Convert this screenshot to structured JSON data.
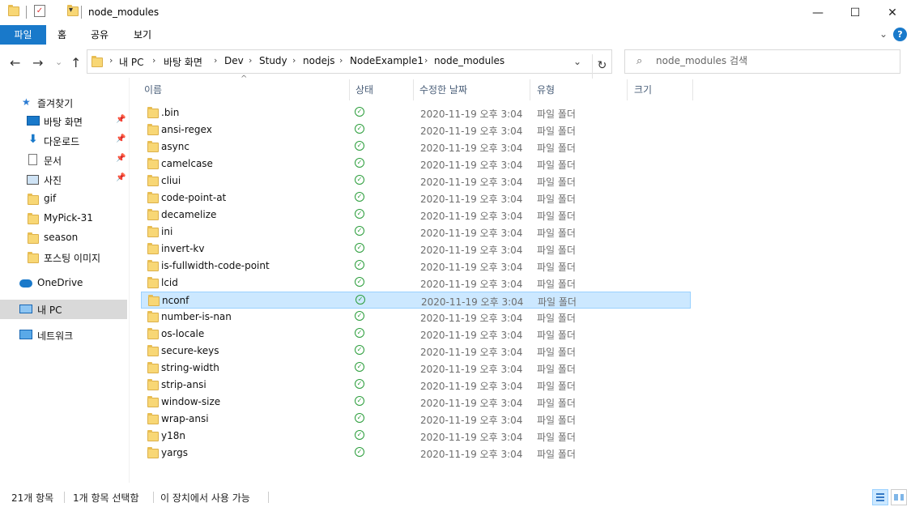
{
  "title": "node_modules",
  "ribbon": {
    "tabs": [
      "파일",
      "홈",
      "공유",
      "보기"
    ]
  },
  "window_controls": {
    "minimize": "—",
    "maximize": "☐",
    "close": "✕"
  },
  "nav": {
    "back": "←",
    "forward": "→",
    "recent": "⌄",
    "up": "↑",
    "refresh": "↻"
  },
  "breadcrumb": [
    "내 PC",
    "바탕 화면",
    "Dev",
    "Study",
    "nodejs",
    "NodeExample1",
    "node_modules"
  ],
  "search": {
    "placeholder": "node_modules 검색"
  },
  "sidebar": {
    "quick_access": "즐겨찾기",
    "items": [
      {
        "label": "바탕 화면",
        "icon": "desktop-icon",
        "pinned": true
      },
      {
        "label": "다운로드",
        "icon": "download-icon",
        "pinned": true
      },
      {
        "label": "문서",
        "icon": "document-icon",
        "pinned": true
      },
      {
        "label": "사진",
        "icon": "picture-icon",
        "pinned": true
      },
      {
        "label": "gif",
        "icon": "folder-icon",
        "pinned": false
      },
      {
        "label": "MyPick-31",
        "icon": "folder-icon",
        "pinned": false
      },
      {
        "label": "season",
        "icon": "folder-icon",
        "pinned": false
      },
      {
        "label": "포스팅 이미지",
        "icon": "folder-icon",
        "pinned": false
      }
    ],
    "onedrive": "OneDrive",
    "this_pc": "내 PC",
    "network": "네트워크"
  },
  "columns": {
    "name": "이름",
    "status": "상태",
    "modified": "수정한 날짜",
    "type": "유형",
    "size": "크기"
  },
  "files": [
    {
      "name": ".bin",
      "date": "2020-11-19 오후 3:04",
      "type": "파일 폴더"
    },
    {
      "name": "ansi-regex",
      "date": "2020-11-19 오후 3:04",
      "type": "파일 폴더"
    },
    {
      "name": "async",
      "date": "2020-11-19 오후 3:04",
      "type": "파일 폴더"
    },
    {
      "name": "camelcase",
      "date": "2020-11-19 오후 3:04",
      "type": "파일 폴더"
    },
    {
      "name": "cliui",
      "date": "2020-11-19 오후 3:04",
      "type": "파일 폴더"
    },
    {
      "name": "code-point-at",
      "date": "2020-11-19 오후 3:04",
      "type": "파일 폴더"
    },
    {
      "name": "decamelize",
      "date": "2020-11-19 오후 3:04",
      "type": "파일 폴더"
    },
    {
      "name": "ini",
      "date": "2020-11-19 오후 3:04",
      "type": "파일 폴더"
    },
    {
      "name": "invert-kv",
      "date": "2020-11-19 오후 3:04",
      "type": "파일 폴더"
    },
    {
      "name": "is-fullwidth-code-point",
      "date": "2020-11-19 오후 3:04",
      "type": "파일 폴더"
    },
    {
      "name": "lcid",
      "date": "2020-11-19 오후 3:04",
      "type": "파일 폴더"
    },
    {
      "name": "nconf",
      "date": "2020-11-19 오후 3:04",
      "type": "파일 폴더",
      "selected": true
    },
    {
      "name": "number-is-nan",
      "date": "2020-11-19 오후 3:04",
      "type": "파일 폴더"
    },
    {
      "name": "os-locale",
      "date": "2020-11-19 오후 3:04",
      "type": "파일 폴더"
    },
    {
      "name": "secure-keys",
      "date": "2020-11-19 오후 3:04",
      "type": "파일 폴더"
    },
    {
      "name": "string-width",
      "date": "2020-11-19 오후 3:04",
      "type": "파일 폴더"
    },
    {
      "name": "strip-ansi",
      "date": "2020-11-19 오후 3:04",
      "type": "파일 폴더"
    },
    {
      "name": "window-size",
      "date": "2020-11-19 오후 3:04",
      "type": "파일 폴더"
    },
    {
      "name": "wrap-ansi",
      "date": "2020-11-19 오후 3:04",
      "type": "파일 폴더"
    },
    {
      "name": "y18n",
      "date": "2020-11-19 오후 3:04",
      "type": "파일 폴더"
    },
    {
      "name": "yargs",
      "date": "2020-11-19 오후 3:04",
      "type": "파일 폴더"
    }
  ],
  "statusbar": {
    "count": "21개 항목",
    "selected": "1개 항목 선택함",
    "availability": "이 장치에서 사용 가능"
  },
  "colors": {
    "accent": "#1979ca",
    "selection": "#cce8ff",
    "selection_border": "#99d1ff",
    "sync_ok": "#2a9d3a"
  }
}
